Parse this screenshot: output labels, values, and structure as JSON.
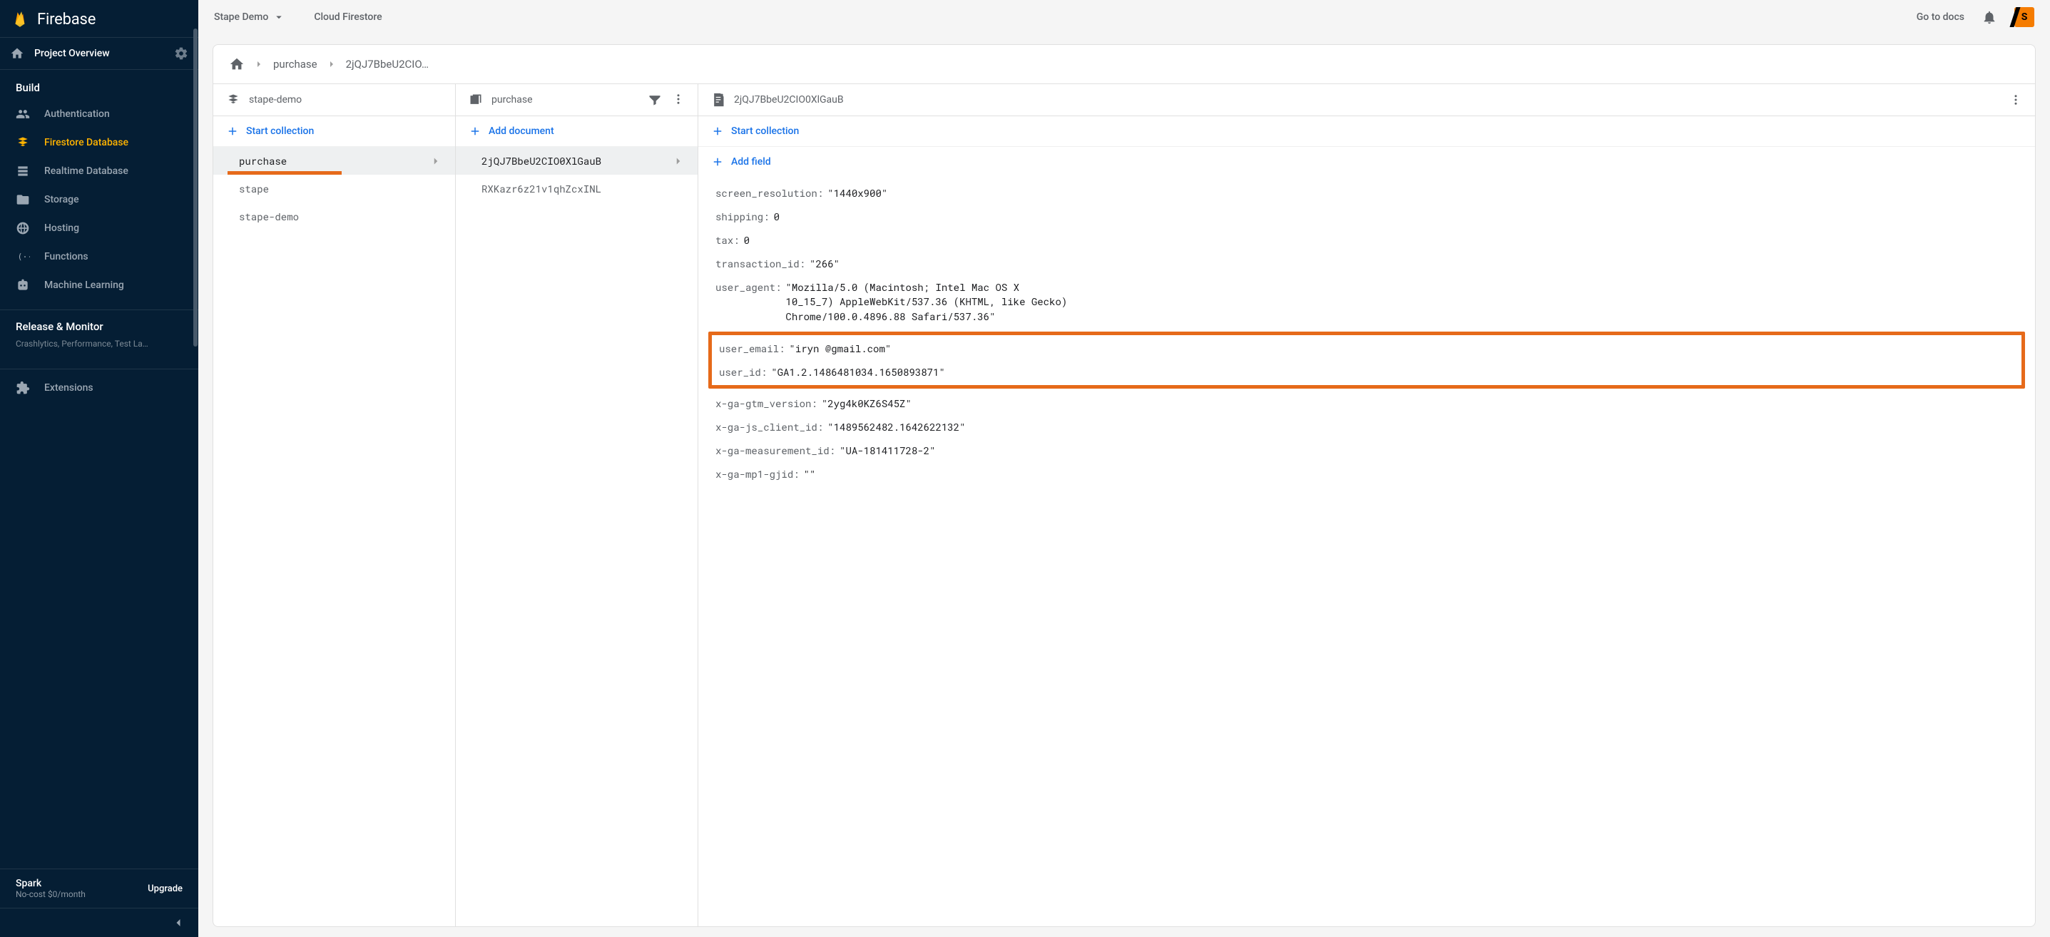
{
  "brand": "Firebase",
  "topbar": {
    "project_name": "Stape Demo",
    "product_name": "Cloud Firestore",
    "docs_link": "Go to docs",
    "avatar_letter": "S"
  },
  "sidebar": {
    "overview_label": "Project Overview",
    "build_section": "Build",
    "nav": [
      {
        "id": "auth",
        "label": "Authentication"
      },
      {
        "id": "firestore",
        "label": "Firestore Database",
        "active": true
      },
      {
        "id": "rtdb",
        "label": "Realtime Database"
      },
      {
        "id": "storage",
        "label": "Storage"
      },
      {
        "id": "hosting",
        "label": "Hosting"
      },
      {
        "id": "functions",
        "label": "Functions"
      },
      {
        "id": "ml",
        "label": "Machine Learning"
      }
    ],
    "release_monitor": {
      "title": "Release & Monitor",
      "subtitle": "Crashlytics, Performance, Test La…"
    },
    "extensions_label": "Extensions",
    "plan": {
      "name": "Spark",
      "subtitle": "No-cost $0/month",
      "upgrade": "Upgrade"
    }
  },
  "breadcrumb": {
    "collection": "purchase",
    "document": "2jQJ7BbeU2CIO…"
  },
  "panels": {
    "root": {
      "title": "stape-demo",
      "start_collection": "Start collection",
      "collections": [
        {
          "name": "purchase",
          "selected": true
        },
        {
          "name": "stape"
        },
        {
          "name": "stape-demo"
        }
      ]
    },
    "collection": {
      "title": "purchase",
      "add_document": "Add document",
      "documents": [
        {
          "id": "2jQJ7BbeU2CIO0XlGauB",
          "selected": true
        },
        {
          "id": "RXKazr6z21v1qhZcxINL"
        }
      ]
    },
    "document": {
      "title": "2jQJ7BbeU2CIO0XlGauB",
      "start_collection": "Start collection",
      "add_field": "Add field",
      "fields": [
        {
          "key": "screen_resolution",
          "value": "1440x900",
          "type": "string"
        },
        {
          "key": "shipping",
          "value": "0",
          "type": "number"
        },
        {
          "key": "tax",
          "value": "0",
          "type": "number"
        },
        {
          "key": "transaction_id",
          "value": "266",
          "type": "string"
        },
        {
          "key": "user_agent",
          "value": "Mozilla/5.0 (Macintosh; Intel Mac OS X 10_15_7) AppleWebKit/537.36 (KHTML, like Gecko) Chrome/100.0.4896.88 Safari/537.36",
          "type": "string",
          "multiline": true
        },
        {
          "key": "user_email",
          "value": "iryn          @gmail.com",
          "type": "string",
          "highlight": true
        },
        {
          "key": "user_id",
          "value": "GA1.2.1486481034.1650893871",
          "type": "string",
          "highlight": true
        },
        {
          "key": "x-ga-gtm_version",
          "value": "2yg4k0KZ6S45Z",
          "type": "string"
        },
        {
          "key": "x-ga-js_client_id",
          "value": "1489562482.1642622132",
          "type": "string"
        },
        {
          "key": "x-ga-measurement_id",
          "value": "UA-181411728-2",
          "type": "string"
        },
        {
          "key": "x-ga-mp1-gjid",
          "value": "",
          "type": "string"
        }
      ]
    }
  }
}
